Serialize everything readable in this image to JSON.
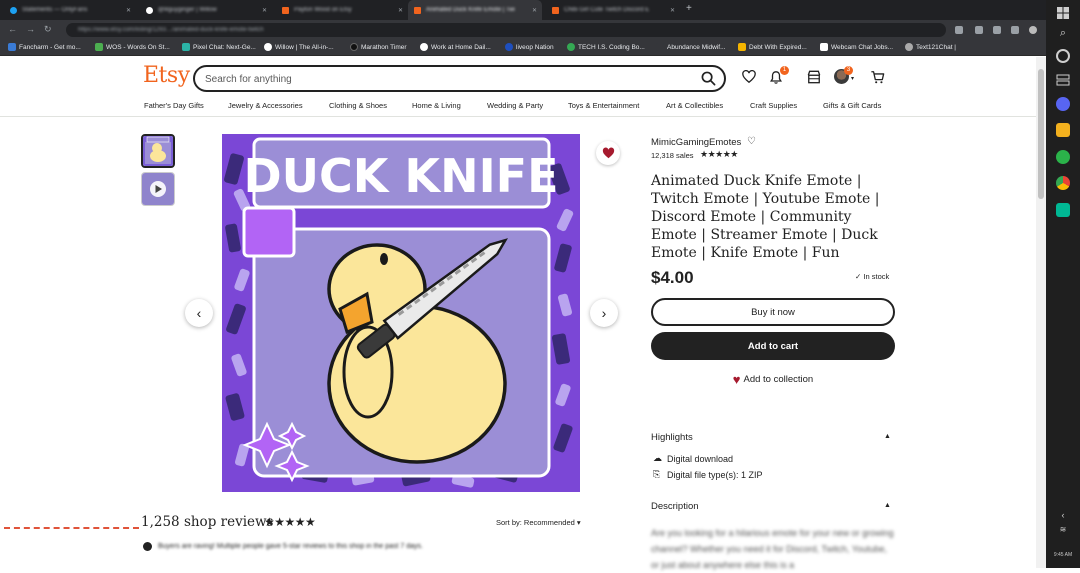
{
  "browser": {
    "tabs": [
      {
        "title": "Statements — OnlyFans",
        "active": false
      },
      {
        "title": "@lilguyginger | Willow",
        "active": false
      },
      {
        "title": "Payton Wood on Etsy",
        "active": false
      },
      {
        "title": "Animated Duck Knife Emote | Twi",
        "active": true
      },
      {
        "title": "Chibi Girl Cute Twitch Discord E",
        "active": false
      }
    ],
    "url": "https://www.etsy.com/listing/1293…/animated-duck-knife-emote-twitch",
    "bookmarks": [
      {
        "label": "Fancharm - Get mo...",
        "color": "#3a7bd5"
      },
      {
        "label": "WOS - Words On St...",
        "color": "#4caf50"
      },
      {
        "label": "Pixel Chat: Next-Ge...",
        "color": "#2bb3a6"
      },
      {
        "label": "Willow | The All-in-...",
        "color": "#ffffff"
      },
      {
        "label": "Marathon Timer",
        "color": "#222222"
      },
      {
        "label": "Work at Home Dail...",
        "color": "#ffffff"
      },
      {
        "label": "liveop Nation",
        "color": "#1e4fbf"
      },
      {
        "label": "TECH I.S. Coding Bo...",
        "color": "#34a853"
      },
      {
        "label": "Abundance Midwif...",
        "color": "#35363a"
      },
      {
        "label": "Debt With Expired...",
        "color": "#f4b400"
      },
      {
        "label": "Webcam Chat Jobs...",
        "color": "#ffffff"
      },
      {
        "label": "Text121Chat |",
        "color": "#aaaaaa"
      }
    ]
  },
  "header": {
    "logo": "Etsy",
    "search_placeholder": "Search for anything",
    "notifications_badge": "1",
    "avatar_badge": "3",
    "categories": [
      "Father's Day Gifts",
      "Jewelry & Accessories",
      "Clothing & Shoes",
      "Home & Living",
      "Wedding & Party",
      "Toys & Entertainment",
      "Art & Collectibles",
      "Craft Supplies",
      "Gifts & Gift Cards"
    ]
  },
  "listing": {
    "image_text": "DUCK KNIFE",
    "shop_name": "MimicGamingEmotes",
    "sales": "12,318 sales",
    "rating_stars": "★★★★★",
    "title": "Animated Duck Knife Emote | Twitch Emote | Youtube Emote | Discord Emote | Community Emote | Streamer Emote | Duck Emote | Knife Emote | Fun",
    "price": "$4.00",
    "stock": "In stock",
    "buy_now_label": "Buy it now",
    "add_to_cart_label": "Add to cart",
    "add_to_collection_label": "Add to collection",
    "highlights_label": "Highlights",
    "highlights": [
      "Digital download",
      "Digital file type(s): 1 ZIP"
    ],
    "description_label": "Description",
    "description_text": "Are you looking for a hilarious emote for your new or growing channel? Whether you need it for Discord, Twitch, Youtube, or just about anywhere else this is a"
  },
  "reviews": {
    "title": "1,258 shop reviews",
    "stars": "★★★★★",
    "sort_label": "Sort by: Recommended",
    "alert_text": "Buyers are raving! Multiple people gave 5-star reviews to this shop in the past 7 days."
  },
  "os": {
    "time": "9:45 AM"
  },
  "colors": {
    "etsy_orange": "#f1641e",
    "image_purple": "#9b8ed6",
    "duck_yellow": "#fbe69a",
    "collection_heart": "#a61a2e"
  }
}
